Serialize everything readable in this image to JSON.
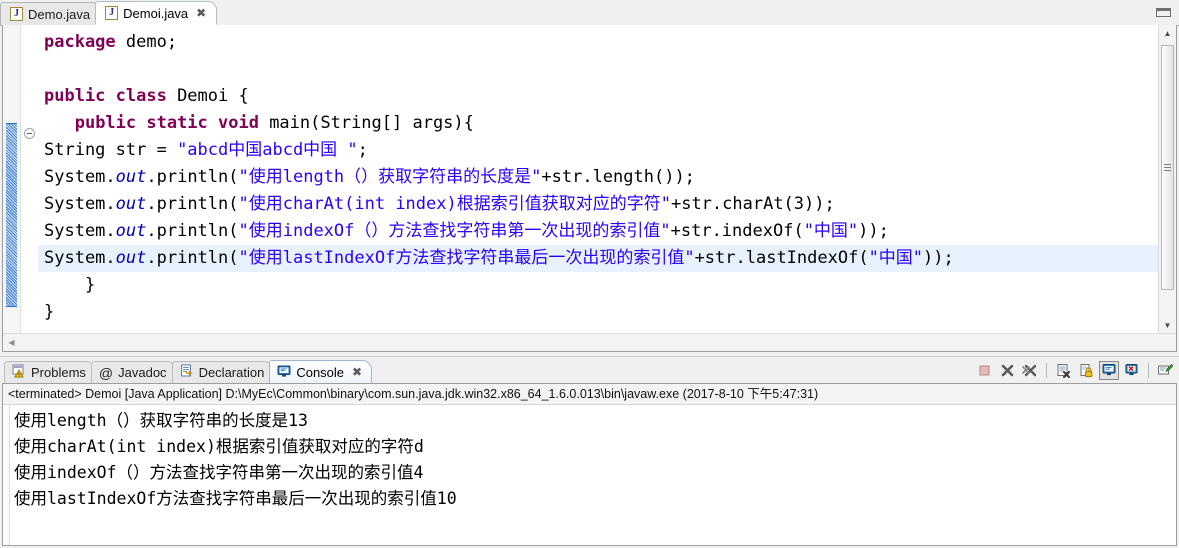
{
  "window": {
    "minimize_label": "▭"
  },
  "editor": {
    "tabs": [
      {
        "label": "Demo.java",
        "icon": "java-file-icon",
        "active": false,
        "closeable": false
      },
      {
        "label": "Demoi.java",
        "icon": "java-file-icon",
        "active": true,
        "closeable": true,
        "close_glyph": "✖"
      }
    ],
    "code_lines": [
      [
        {
          "t": "package",
          "c": "kw"
        },
        {
          "t": " demo;",
          "c": ""
        }
      ],
      [
        {
          "t": "",
          "c": ""
        }
      ],
      [
        {
          "t": "public class",
          "c": "kw"
        },
        {
          "t": " Demoi {",
          "c": ""
        }
      ],
      [
        {
          "t": "   ",
          "c": ""
        },
        {
          "t": "public static void",
          "c": "kw"
        },
        {
          "t": " main(String[] args){",
          "c": ""
        }
      ],
      [
        {
          "t": "String str = ",
          "c": ""
        },
        {
          "t": "\"abcd中国abcd中国 \"",
          "c": "str"
        },
        {
          "t": ";",
          "c": ""
        }
      ],
      [
        {
          "t": "System.",
          "c": ""
        },
        {
          "t": "out",
          "c": "fld"
        },
        {
          "t": ".println(",
          "c": ""
        },
        {
          "t": "\"使用length（）获取字符串的长度是\"",
          "c": "str"
        },
        {
          "t": "+str.length());",
          "c": ""
        }
      ],
      [
        {
          "t": "System.",
          "c": ""
        },
        {
          "t": "out",
          "c": "fld"
        },
        {
          "t": ".println(",
          "c": ""
        },
        {
          "t": "\"使用charAt(int index)根据索引值获取对应的字符\"",
          "c": "str"
        },
        {
          "t": "+str.charAt(3));",
          "c": ""
        }
      ],
      [
        {
          "t": "System.",
          "c": ""
        },
        {
          "t": "out",
          "c": "fld"
        },
        {
          "t": ".println(",
          "c": ""
        },
        {
          "t": "\"使用indexOf（）方法查找字符串第一次出现的索引值\"",
          "c": "str"
        },
        {
          "t": "+str.indexOf(",
          "c": ""
        },
        {
          "t": "\"中国\"",
          "c": "str"
        },
        {
          "t": "));",
          "c": ""
        }
      ],
      [
        {
          "t": "System.",
          "c": ""
        },
        {
          "t": "out",
          "c": "fld"
        },
        {
          "t": ".println(",
          "c": ""
        },
        {
          "t": "\"使用lastIndexOf方法查找字符串最后一次出现的索引值\"",
          "c": "str"
        },
        {
          "t": "+str.lastIndexOf(",
          "c": ""
        },
        {
          "t": "\"中国\"",
          "c": "str"
        },
        {
          "t": "));",
          "c": ""
        }
      ],
      [
        {
          "t": "    }",
          "c": ""
        }
      ],
      [
        {
          "t": "}",
          "c": ""
        }
      ]
    ],
    "current_line_index": 8,
    "scroll": {
      "up_arrow": "▲",
      "down_arrow": "▼",
      "left_arrow": "◀"
    }
  },
  "console_panel": {
    "tabs": [
      {
        "label": "Problems",
        "icon": "problems-icon",
        "active": false
      },
      {
        "label": "Javadoc",
        "icon": "javadoc-at-icon",
        "active": false
      },
      {
        "label": "Declaration",
        "icon": "declaration-icon",
        "active": false
      },
      {
        "label": "Console",
        "icon": "console-icon",
        "active": true,
        "close_glyph": "✖"
      }
    ],
    "toolbar": [
      {
        "name": "terminate-button",
        "glyph": "■"
      },
      {
        "name": "remove-launch-button",
        "glyph": "✖"
      },
      {
        "name": "remove-all-terminated-button",
        "glyph": "✖"
      },
      {
        "name": "clear-console-button",
        "glyph": "▤"
      },
      {
        "name": "scroll-lock-button",
        "glyph": "🔒"
      },
      {
        "name": "display-selected-console-button",
        "glyph": "▣"
      },
      {
        "name": "open-console-button",
        "glyph": "▥"
      },
      {
        "name": "pin-console-button",
        "glyph": "▤"
      }
    ],
    "status_line": "<terminated> Demoi [Java Application] D:\\MyEc\\Common\\binary\\com.sun.java.jdk.win32.x86_64_1.6.0.013\\bin\\javaw.exe (2017-8-10 下午5:47:31)",
    "output_lines": [
      "使用length（）获取字符串的长度是13",
      "使用charAt(int index)根据索引值获取对应的字符d",
      "使用indexOf（）方法查找字符串第一次出现的索引值4",
      "使用lastIndexOf方法查找字符串最后一次出现的索引值10"
    ]
  },
  "colors": {
    "keyword": "#7f0055",
    "string": "#2a00ff",
    "field": "#0000c0",
    "current_line_highlight": "#e8f2fe",
    "change_bar": "#3a7ddb"
  }
}
